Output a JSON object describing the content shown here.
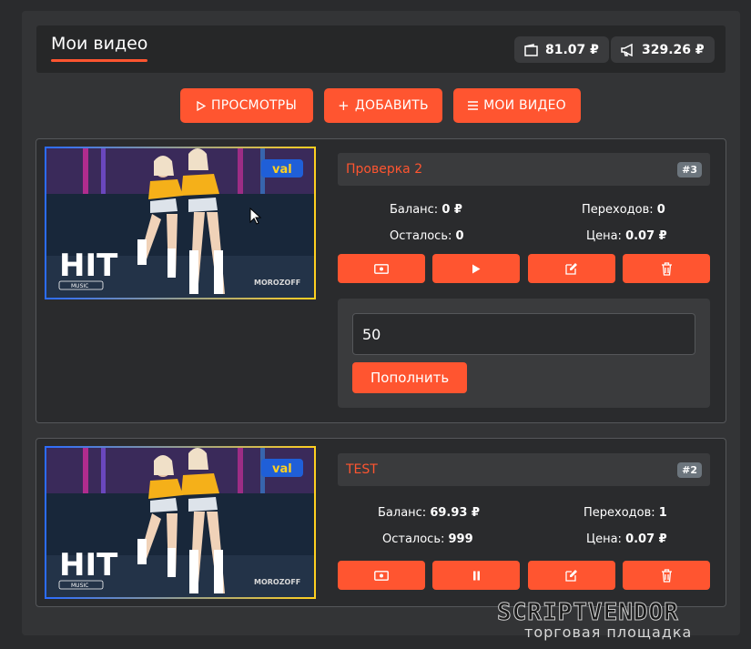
{
  "header": {
    "title": "Мои видео",
    "wallet_balance": "81.07 ₽",
    "ad_balance": "329.26 ₽"
  },
  "toolbar": {
    "views_label": "ПРОСМОТРЫ",
    "add_label": "ДОБАВИТЬ",
    "my_videos_label": "МОИ ВИДЕО"
  },
  "videos": [
    {
      "title": "Проверка 2",
      "id": "#3",
      "balance_label": "Баланс:",
      "balance": "0 ₽",
      "clicks_label": "Переходов:",
      "clicks": "0",
      "remaining_label": "Осталось:",
      "remaining": "0",
      "price_label": "Цена:",
      "price": "0.07 ₽",
      "thumb_logo": "HIT",
      "thumb_music": "MUSIC",
      "thumb_brand": "MOROZOFF",
      "thumb_tag": "val",
      "state": "stopped"
    },
    {
      "title": "TEST",
      "id": "#2",
      "balance_label": "Баланс:",
      "balance": "69.93 ₽",
      "clicks_label": "Переходов:",
      "clicks": "1",
      "remaining_label": "Осталось:",
      "remaining": "999",
      "price_label": "Цена:",
      "price": "0.07 ₽",
      "thumb_logo": "HIT",
      "thumb_music": "MUSIC",
      "thumb_brand": "MOROZOFF",
      "thumb_tag": "val",
      "state": "playing"
    }
  ],
  "topup": {
    "amount": "50",
    "button_label": "Пополнить"
  },
  "watermark": {
    "brand": "SCRIPTVENDOR",
    "subtitle": "торговая площадка"
  },
  "colors": {
    "accent": "#ff5530",
    "background": "#2a2b2d",
    "panel": "#333436"
  },
  "icons": [
    "wallet-icon",
    "megaphone-icon",
    "play-outline-icon",
    "plus-icon",
    "list-icon",
    "cash-icon",
    "play-icon",
    "pause-icon",
    "edit-icon",
    "trash-icon"
  ]
}
